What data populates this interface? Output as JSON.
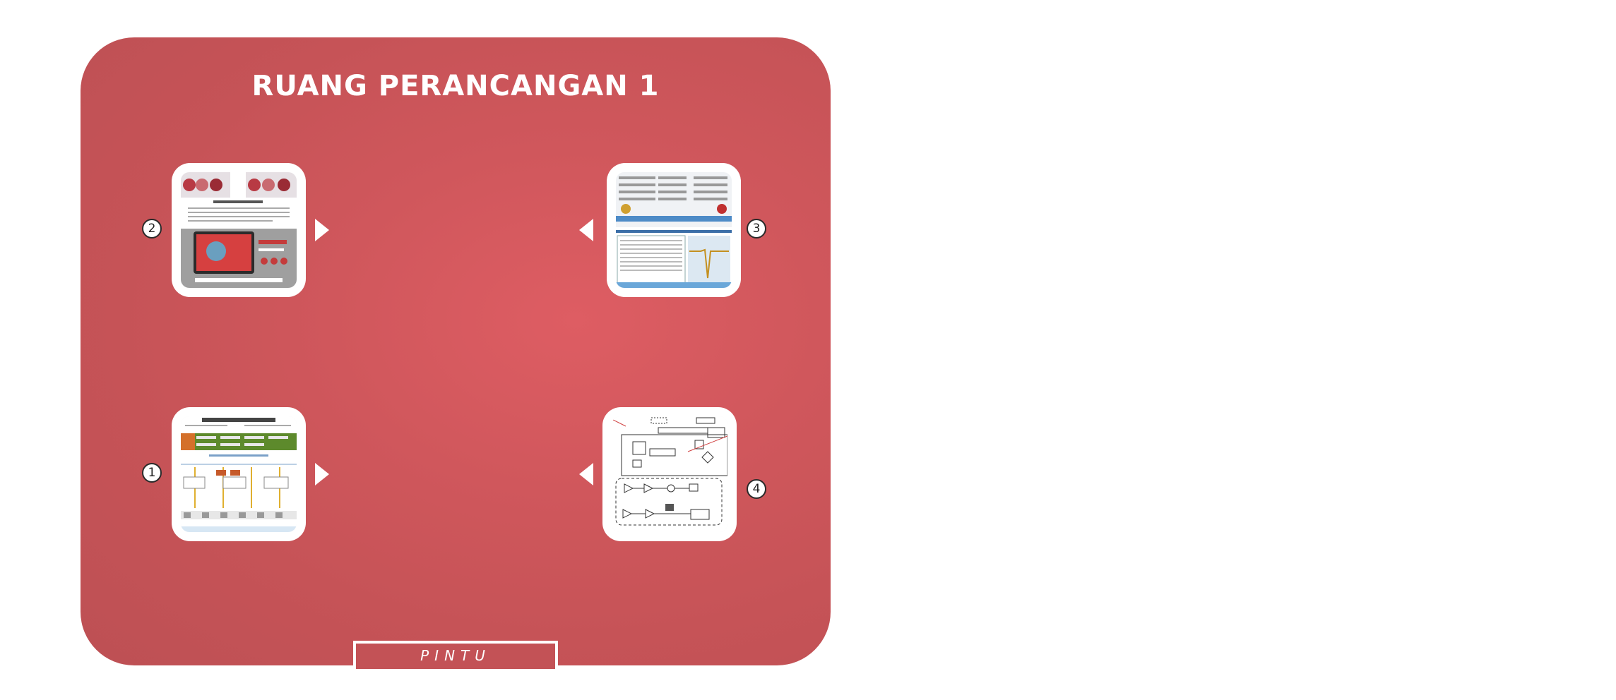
{
  "room": {
    "title": "RUANG PERANCANGAN 1",
    "background_color": "#cd565b",
    "door_label": "PINTU"
  },
  "exhibits": [
    {
      "number": "1",
      "name": "exhibit-1",
      "thumbnail": "system-diagram-page",
      "arrow": "right"
    },
    {
      "number": "2",
      "name": "exhibit-2",
      "thumbnail": "app-poster-page",
      "arrow": "right"
    },
    {
      "number": "3",
      "name": "exhibit-3",
      "thumbnail": "software-screenshot",
      "arrow": "left"
    },
    {
      "number": "4",
      "name": "exhibit-4",
      "thumbnail": "block-diagram",
      "arrow": "left"
    }
  ]
}
